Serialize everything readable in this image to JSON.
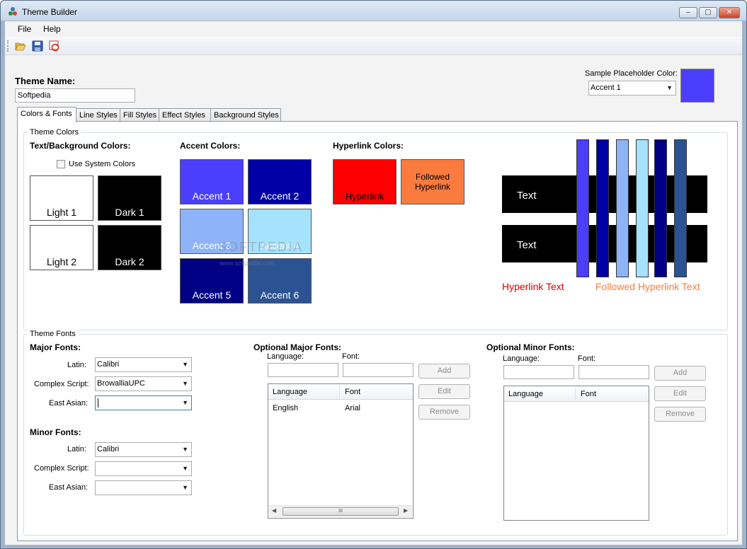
{
  "window": {
    "title": "Theme Builder",
    "min_label": "–",
    "max_label": "▢",
    "close_label": "✕"
  },
  "menu": {
    "file": "File",
    "help": "Help"
  },
  "toolbar": {
    "open_icon": "folder-open-icon",
    "save_icon": "save-icon",
    "refresh_icon": "refresh-icon"
  },
  "theme_name": {
    "label": "Theme Name:",
    "value": "Softpedia"
  },
  "sample_placeholder": {
    "label": "Sample Placeholder Color:",
    "selected": "Accent 1",
    "color": "#4b3ffc"
  },
  "tabs": [
    "Colors & Fonts",
    "Line Styles",
    "Fill Styles",
    "Effect Styles",
    "Background Styles"
  ],
  "theme_colors": {
    "title": "Theme Colors",
    "text_bg": {
      "heading": "Text/Background Colors:",
      "use_system": "Use System Colors",
      "swatches": [
        {
          "label": "Light 1",
          "color": "#ffffff",
          "text_color": "#000000"
        },
        {
          "label": "Dark 1",
          "color": "#000000",
          "text_color": "#ffffff"
        },
        {
          "label": "Light 2",
          "color": "#ffffff",
          "text_color": "#000000"
        },
        {
          "label": "Dark 2",
          "color": "#000000",
          "text_color": "#ffffff"
        }
      ]
    },
    "accent": {
      "heading": "Accent Colors:",
      "swatches": [
        {
          "label": "Accent 1",
          "color": "#4b3ffc"
        },
        {
          "label": "Accent 2",
          "color": "#0000a6"
        },
        {
          "label": "Accent 3",
          "color": "#8eb3f9"
        },
        {
          "label": "Accent 4",
          "color": "#a5e2fd"
        },
        {
          "label": "Accent 5",
          "color": "#000084"
        },
        {
          "label": "Accent 6",
          "color": "#2b5393"
        }
      ]
    },
    "hyperlink": {
      "heading": "Hyperlink Colors:",
      "hyperlink": {
        "label": "Hyperlink",
        "color": "#ff0000"
      },
      "followed": {
        "label": "Followed Hyperlink",
        "color": "#fb7b3f"
      }
    },
    "preview": {
      "text1": "Text",
      "text2": "Text",
      "hyperlink_text": "Hyperlink Text",
      "followed_text": "Followed Hyperlink Text"
    }
  },
  "theme_fonts": {
    "title": "Theme Fonts",
    "major": {
      "heading": "Major Fonts:",
      "latin_label": "Latin:",
      "latin": "Calibri",
      "complex_label": "Complex Script:",
      "complex": "BrowalliaUPC",
      "east_label": "East Asian:",
      "east": ""
    },
    "minor": {
      "heading": "Minor Fonts:",
      "latin_label": "Latin:",
      "latin": "Calibri",
      "complex_label": "Complex Script:",
      "complex": "",
      "east_label": "East Asian:",
      "east": ""
    },
    "optional_major": {
      "heading": "Optional Major Fonts:",
      "language_label": "Language:",
      "font_label": "Font:",
      "col_language": "Language",
      "col_font": "Font",
      "rows": [
        {
          "language": "English",
          "font": "Arial"
        }
      ],
      "add": "Add",
      "edit": "Edit",
      "remove": "Remove",
      "scroll_grip": "III"
    },
    "optional_minor": {
      "heading": "Optional Minor Fonts:",
      "language_label": "Language:",
      "font_label": "Font:",
      "col_language": "Language",
      "col_font": "Font",
      "add": "Add",
      "edit": "Edit",
      "remove": "Remove"
    }
  },
  "watermark": {
    "text": "SOFTPEDIA",
    "url": "www.softpedia.com"
  }
}
